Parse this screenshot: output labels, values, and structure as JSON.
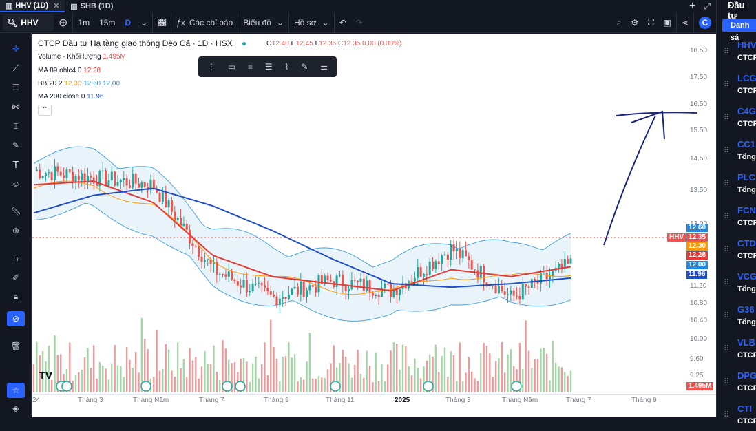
{
  "tabs": [
    {
      "label": "HHV (1D)",
      "active": true
    },
    {
      "label": "SHB (1D)",
      "active": false
    }
  ],
  "toolbar": {
    "symbol": "HHV",
    "interval_1m": "1m",
    "interval_15m": "15m",
    "interval_d": "D",
    "indicators": "Các chỉ báo",
    "chart_type": "Biểu đồ",
    "profile": "Hồ sơ"
  },
  "legend": {
    "title": "CTCP Đầu tư Hạ tầng giao thông Đèo Cả · 1D · HSX",
    "o": "O",
    "o_val": "12.40",
    "h": "H",
    "h_val": "12.45",
    "l": "L",
    "l_val": "12.35",
    "c": "C",
    "c_val": "12.35",
    "chg": "0.00 (0.00%)",
    "volume_label": "Volume - Khối lượng",
    "volume_val": "1.495M",
    "ma89_label": "MA 89 ohlc4 0",
    "ma89_val": "12.28",
    "bb_label": "BB 20 2",
    "bb_v1": "12.30",
    "bb_v2": "12.60",
    "bb_v3": "12.00",
    "ma200_label": "MA 200 close 0",
    "ma200_val": "11.96"
  },
  "price_axis": [
    "18.50",
    "17.50",
    "16.50",
    "15.50",
    "14.50",
    "13.50",
    "13.00",
    "11.20",
    "10.80",
    "10.40",
    "10.00",
    "9.60",
    "9.25"
  ],
  "price_tags": {
    "bb_upper": "12.60",
    "symbol": "HHV",
    "last": "12.35",
    "bb_mid": "12.30",
    "ma89": "12.28",
    "bb_lower": "12.00",
    "ma200": "11.96",
    "volume": "1.495M"
  },
  "time_axis": [
    "24",
    "Tháng 3",
    "Tháng Năm",
    "Tháng 7",
    "Tháng 9",
    "Tháng 11",
    "2025",
    "Tháng 3",
    "Tháng Năm",
    "Tháng 7",
    "Tháng 9"
  ],
  "watchlist": {
    "header": "Đầu tư",
    "button": "Danh sá",
    "items": [
      {
        "ticker": "HHV",
        "name": "CTCP"
      },
      {
        "ticker": "LCG",
        "name": "CTCP"
      },
      {
        "ticker": "C4G",
        "name": "CTCP"
      },
      {
        "ticker": "CC1",
        "name": "Tổng"
      },
      {
        "ticker": "PLC",
        "name": "Tổng"
      },
      {
        "ticker": "FCN",
        "name": "CTCP"
      },
      {
        "ticker": "CTD",
        "name": "CTCP"
      },
      {
        "ticker": "VCG",
        "name": "Tổng"
      },
      {
        "ticker": "G36",
        "name": "Tổng"
      },
      {
        "ticker": "VLB",
        "name": "CTCP"
      },
      {
        "ticker": "DPG",
        "name": "CTCP"
      },
      {
        "ticker": "CTI",
        "name": "CTCP"
      }
    ]
  },
  "chart_data": {
    "type": "line",
    "title": "CTCP Đầu tư Hạ tầng giao thông Đèo Cả · 1D · HSX",
    "x": [
      "24",
      "Tháng 3",
      "Tháng Năm",
      "Tháng 7",
      "Tháng 9",
      "Tháng 11",
      "2025",
      "Tháng 3",
      "Tháng Năm",
      "Tháng 7"
    ],
    "series": [
      {
        "name": "HHV",
        "values": [
          15.0,
          14.8,
          14.6,
          12.2,
          11.4,
          11.9,
          11.6,
          12.8,
          11.4,
          12.35
        ]
      },
      {
        "name": "MA 89 ohlc4 0",
        "values": [
          14.6,
          14.7,
          14.1,
          12.6,
          12.0,
          11.8,
          11.6,
          12.2,
          12.0,
          12.28
        ]
      },
      {
        "name": "MA 200 close 0",
        "values": [
          13.8,
          14.3,
          14.5,
          14.0,
          13.3,
          12.5,
          11.8,
          11.7,
          11.8,
          11.96
        ]
      }
    ],
    "ylim": [
      9.25,
      18.5
    ],
    "colors": {
      "ma89": "#e53935",
      "ma200": "#1e4fc6",
      "bb": "#4aa3d6",
      "candle_up": "#26a69a",
      "candle_down": "#ef5350"
    }
  }
}
